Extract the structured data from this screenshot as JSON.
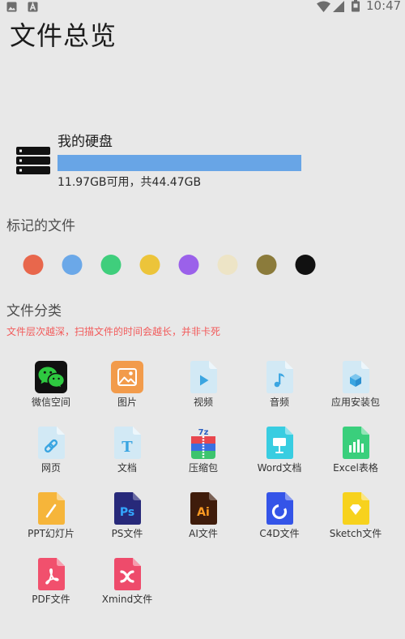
{
  "status_bar": {
    "time": "10:47",
    "left_icons": [
      "gallery-icon",
      "notification-a-icon"
    ],
    "right_icons": [
      "wifi-icon",
      "signal-icon",
      "battery-icon"
    ]
  },
  "page": {
    "title": "文件总览"
  },
  "storage": {
    "icon": "server-icon",
    "name": "我的硬盘",
    "summary": "11.97GB可用，共44.47GB",
    "used_fraction": 0.73,
    "bar_color": "#68a5e6"
  },
  "marked_files": {
    "heading": "标记的文件",
    "tags": [
      {
        "color": "#e8674c"
      },
      {
        "color": "#6ba8e8"
      },
      {
        "color": "#3fce7c"
      },
      {
        "color": "#ecc43a"
      },
      {
        "color": "#9b61ea"
      },
      {
        "color": "#ede4c6"
      },
      {
        "color": "#8b7b3b"
      },
      {
        "color": "#111111"
      }
    ]
  },
  "categories": {
    "heading": "文件分类",
    "note": "文件层次越深，扫描文件的时间会越长，并非卡死",
    "note_color": "#f25b5b",
    "items": [
      {
        "label": "微信空间",
        "icon": "wechat-icon",
        "color": "#111111"
      },
      {
        "label": "图片",
        "icon": "image-icon",
        "color": "#f29b4b"
      },
      {
        "label": "视频",
        "icon": "video-file-icon",
        "color": "#d2e9f5"
      },
      {
        "label": "音频",
        "icon": "audio-file-icon",
        "color": "#d2e9f5"
      },
      {
        "label": "应用安装包",
        "icon": "package-file-icon",
        "color": "#d2e9f5"
      },
      {
        "label": "网页",
        "icon": "link-file-icon",
        "color": "#d2e9f5"
      },
      {
        "label": "文档",
        "icon": "text-file-icon",
        "color": "#d2e9f5",
        "glyph": "T"
      },
      {
        "label": "压缩包",
        "icon": "zip-icon",
        "color": "#e8474d",
        "glyph": "7z"
      },
      {
        "label": "Word文档",
        "icon": "word-file-icon",
        "color": "#38cde1"
      },
      {
        "label": "Excel表格",
        "icon": "excel-file-icon",
        "color": "#3acf7c"
      },
      {
        "label": "PPT幻灯片",
        "icon": "ppt-file-icon",
        "color": "#f6b53a"
      },
      {
        "label": "PS文件",
        "icon": "ps-file-icon",
        "color": "#27297a",
        "glyph": "Ps"
      },
      {
        "label": "AI文件",
        "icon": "ai-file-icon",
        "color": "#3f1c0b",
        "glyph": "Ai"
      },
      {
        "label": "C4D文件",
        "icon": "c4d-file-icon",
        "color": "#3454e8"
      },
      {
        "label": "Sketch文件",
        "icon": "sketch-file-icon",
        "color": "#f7d21d"
      },
      {
        "label": "PDF文件",
        "icon": "pdf-file-icon",
        "color": "#f1506d"
      },
      {
        "label": "Xmind文件",
        "icon": "xmind-file-icon",
        "color": "#ee4b6b"
      }
    ]
  }
}
